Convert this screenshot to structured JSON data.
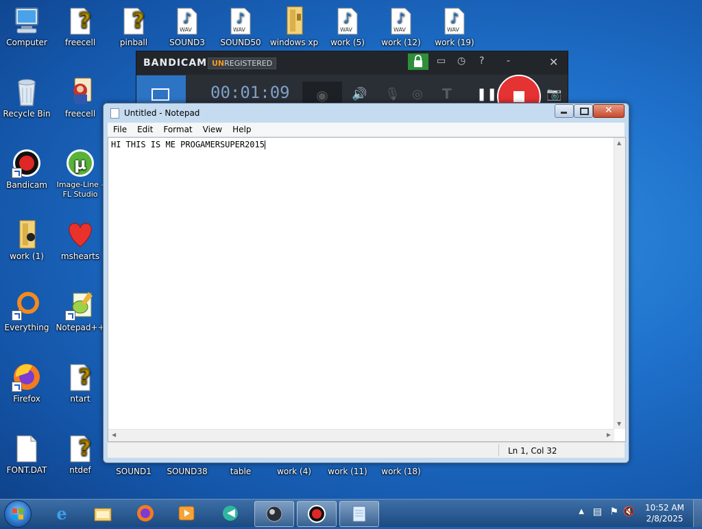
{
  "desktop": {
    "icons": [
      {
        "label": "Computer",
        "icon": "computer-icon"
      },
      {
        "label": "freecell",
        "icon": "unknown-file-icon"
      },
      {
        "label": "pinball",
        "icon": "unknown-file-icon"
      },
      {
        "label": "SOUND3",
        "icon": "wav-file-icon"
      },
      {
        "label": "SOUND50",
        "icon": "wav-file-icon"
      },
      {
        "label": "windows xp",
        "icon": "folder-icon"
      },
      {
        "label": "work (5)",
        "icon": "wav-file-icon"
      },
      {
        "label": "work (12)",
        "icon": "wav-file-icon"
      },
      {
        "label": "work (19)",
        "icon": "wav-file-icon"
      },
      {
        "label": "Recycle Bin",
        "icon": "recycle-bin-icon"
      },
      {
        "label": "freecell",
        "icon": "freecell-game-icon"
      },
      {
        "label": "Bandicam",
        "icon": "bandicam-icon"
      },
      {
        "label": "Image-Line - FL Studio 11...",
        "icon": "utorrent-icon"
      },
      {
        "label": "work (1)",
        "icon": "folder-icon"
      },
      {
        "label": "mshearts",
        "icon": "heart-icon"
      },
      {
        "label": "Everything",
        "icon": "everything-search-icon"
      },
      {
        "label": "Notepad++",
        "icon": "notepad-plus-plus-icon"
      },
      {
        "label": "Firefox",
        "icon": "firefox-icon"
      },
      {
        "label": "ntart",
        "icon": "unknown-file-icon"
      },
      {
        "label": "FONT.DAT",
        "icon": "blank-file-icon"
      },
      {
        "label": "ntdef",
        "icon": "unknown-file-icon"
      },
      {
        "label": "SOUND1",
        "icon": "wav-file-icon"
      },
      {
        "label": "SOUND38",
        "icon": "wav-file-icon"
      },
      {
        "label": "table",
        "icon": "file-icon"
      },
      {
        "label": "work (4)",
        "icon": "wav-file-icon"
      },
      {
        "label": "work (11)",
        "icon": "wav-file-icon"
      },
      {
        "label": "work (18)",
        "icon": "wav-file-icon"
      }
    ],
    "wav_badge": "WAV"
  },
  "bandicam": {
    "brand": "BANDICAM",
    "unreg_prefix": "UN",
    "unreg_rest": "REGISTERED",
    "timer": "00:01:09",
    "controls": [
      "folder-icon",
      "clock-icon",
      "help-icon",
      "minimize-icon",
      "close-icon"
    ],
    "toolbar": [
      "screen-mode-icon",
      "webcam-icon",
      "speaker-icon",
      "microphone-icon",
      "mouse-cursor-icon",
      "text-icon",
      "pause-icon",
      "stop-record-icon",
      "camera-icon"
    ]
  },
  "notepad": {
    "title": "Untitled - Notepad",
    "menu": [
      "File",
      "Edit",
      "Format",
      "View",
      "Help"
    ],
    "content": "HI THIS IS ME PROGAMERSUPER2015",
    "status": "Ln 1, Col 32"
  },
  "taskbar": {
    "apps": [
      "internet-explorer-icon",
      "file-explorer-icon",
      "firefox-icon",
      "media-player-icon",
      "game-icon",
      "dark-orb-icon",
      "bandicam-icon",
      "notepad-icon"
    ],
    "tray": [
      "chevron-up-icon",
      "network-icon",
      "flag-icon",
      "speaker-muted-icon"
    ],
    "time": "10:52 AM",
    "date": "2/8/2025"
  },
  "colors": {
    "desktop_blue": "#1e6fc9",
    "bandicam_red": "#e53232",
    "taskbar_blue": "#2a5b91"
  }
}
